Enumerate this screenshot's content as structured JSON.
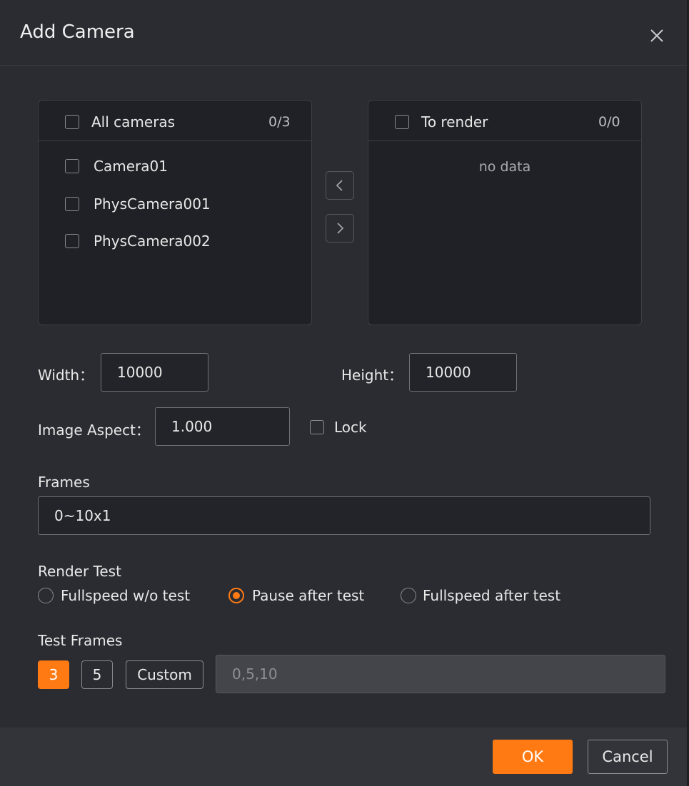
{
  "dialog": {
    "title": "Add Camera",
    "close_icon": "close-icon"
  },
  "source_list": {
    "header_label": "All cameras",
    "count": "0/3",
    "items": [
      "Camera01",
      "PhysCamera001",
      "PhysCamera002"
    ]
  },
  "target_list": {
    "header_label": "To render",
    "count": "0/0",
    "empty_text": "no data"
  },
  "transfer_buttons": {
    "left_icon": "chevron-left-icon",
    "right_icon": "chevron-right-icon"
  },
  "size": {
    "width_label": "Width：",
    "width_value": "10000",
    "height_label": "Height：",
    "height_value": "10000",
    "aspect_label": "Image Aspect：",
    "aspect_value": "1.000",
    "lock_label": "Lock"
  },
  "frames": {
    "label": "Frames",
    "value": "0~10x1"
  },
  "render_test": {
    "label": "Render Test",
    "options": [
      "Fullspeed w/o test",
      "Pause after test",
      "Fullspeed after test"
    ],
    "selected": "Pause after test"
  },
  "test_frames": {
    "label": "Test Frames",
    "chips": [
      "3",
      "5",
      "Custom"
    ],
    "selected": "3",
    "custom_placeholder": "0,5,10"
  },
  "footer": {
    "ok_label": "OK",
    "cancel_label": "Cancel"
  },
  "colors": {
    "accent": "#ff7a12",
    "background": "#2b2c32",
    "panel": "#202126"
  }
}
